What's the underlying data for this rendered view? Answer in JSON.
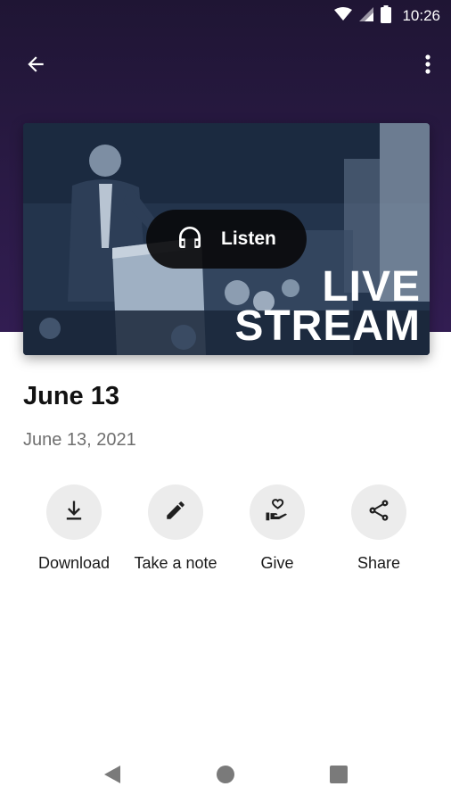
{
  "status_bar": {
    "time": "10:26",
    "icons": [
      "wifi-icon",
      "signal-icon",
      "battery-icon"
    ]
  },
  "app_bar": {
    "back_icon": "arrow-left-icon",
    "more_icon": "more-vert-icon"
  },
  "hero": {
    "overlay_line1": "LIVE",
    "overlay_line2": "STREAM",
    "listen_label": "Listen",
    "listen_icon": "headphones-icon"
  },
  "sermon": {
    "title": "June 13",
    "date": "June 13, 2021"
  },
  "actions": [
    {
      "label": "Download",
      "icon": "download-icon"
    },
    {
      "label": "Take a note",
      "icon": "pencil-icon"
    },
    {
      "label": "Give",
      "icon": "give-hand-heart-icon"
    },
    {
      "label": "Share",
      "icon": "share-icon"
    }
  ],
  "navigation": {
    "icons": [
      "nav-back-icon",
      "nav-home-icon",
      "nav-recents-icon"
    ]
  },
  "colors": {
    "header": "#2a1a45",
    "action_circle": "#ececec",
    "date_text": "#6f6f6f"
  }
}
